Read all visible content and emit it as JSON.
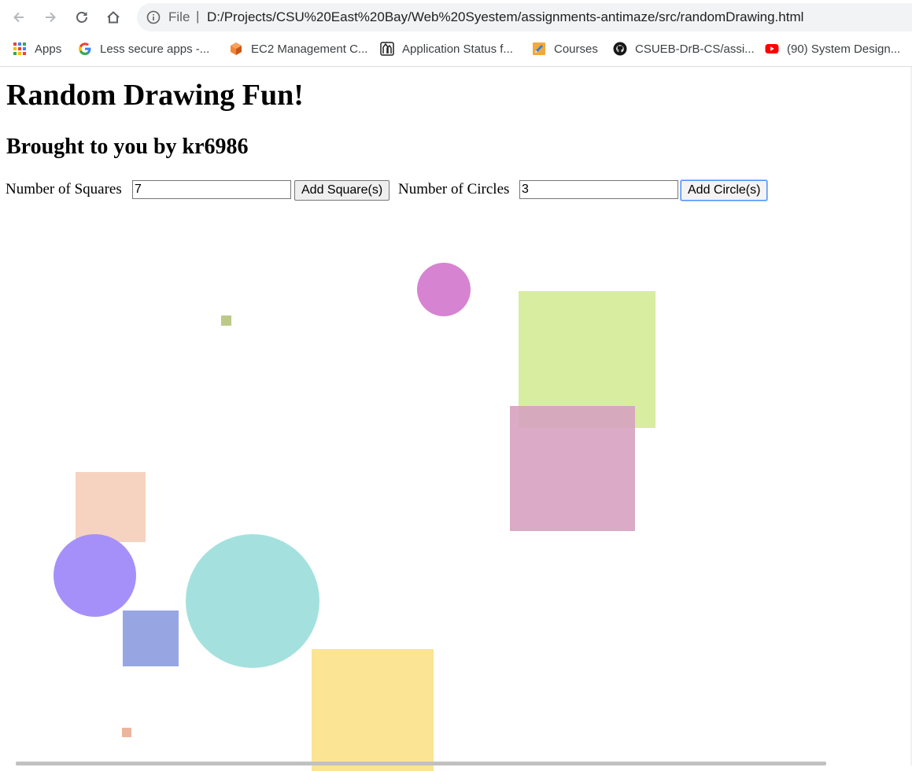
{
  "browser": {
    "scheme": "File",
    "separator": "|",
    "url": "D:/Projects/CSU%20East%20Bay/Web%20Syestem/assignments-antimaze/src/randomDrawing.html",
    "bookmarks": [
      {
        "label": "Apps",
        "icon": "apps-grid-icon"
      },
      {
        "label": "Less secure apps -...",
        "icon": "google-icon"
      },
      {
        "label": "EC2 Management C...",
        "icon": "aws-cube-icon"
      },
      {
        "label": "Application Status f...",
        "icon": "app-status-icon"
      },
      {
        "label": "Courses",
        "icon": "pencil-icon"
      },
      {
        "label": "CSUEB-DrB-CS/assi...",
        "icon": "github-icon"
      },
      {
        "label": "(90) System Design...",
        "icon": "youtube-icon"
      }
    ]
  },
  "page": {
    "title": "Random Drawing Fun!",
    "subtitle": "Brought to you by kr6986",
    "squares_label": "Number of Squares",
    "squares_value": "7",
    "add_squares_label": "Add Square(s)",
    "circles_label": "Number of Circles",
    "circles_value": "3",
    "add_circles_label": "Add Circle(s)"
  },
  "drawing": {
    "squares": [
      {
        "color": "#bcc98a"
      },
      {
        "color": "#d8eda0"
      },
      {
        "color": "#d7a1c0"
      },
      {
        "color": "#f6d2c0"
      },
      {
        "color": "#97a6e3"
      },
      {
        "color": "#fbe494"
      },
      {
        "color": "#ebb69d"
      }
    ],
    "circles": [
      {
        "color": "#d683d2"
      },
      {
        "color": "#a590fa"
      },
      {
        "color": "#a4e1de"
      }
    ]
  }
}
